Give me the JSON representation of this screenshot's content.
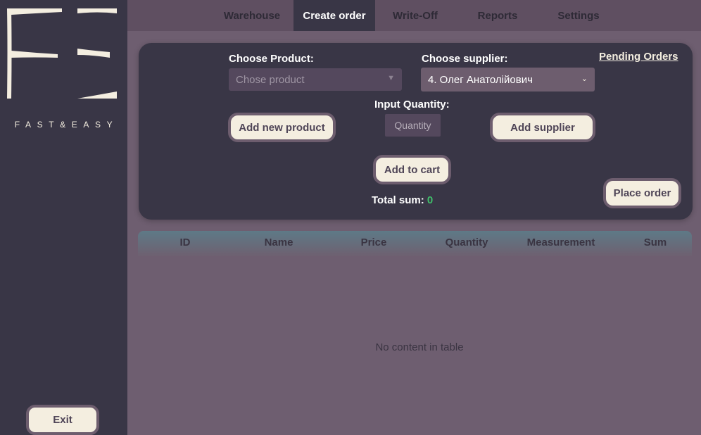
{
  "sidebar": {
    "logo_subtitle": "FAST&EASY",
    "exit_label": "Exit"
  },
  "nav": {
    "tabs": [
      {
        "label": "Warehouse"
      },
      {
        "label": "Create order"
      },
      {
        "label": "Write-Off"
      },
      {
        "label": "Reports"
      },
      {
        "label": "Settings"
      }
    ],
    "active_tab": "Create order"
  },
  "order_form": {
    "product_label": "Choose Product:",
    "product_placeholder": "Chose product",
    "supplier_label": "Choose supplier:",
    "supplier_value": "4. Олег Анатолійович",
    "pending_link": "Pending Orders",
    "quantity_label": "Input Quantity:",
    "quantity_placeholder": "Quantity",
    "add_product_label": "Add new product",
    "add_supplier_label": "Add supplier",
    "add_to_cart_label": "Add to cart",
    "total_label": "Total sum:",
    "total_value": "0",
    "place_order_label": "Place order"
  },
  "table": {
    "columns": [
      "ID",
      "Name",
      "Price",
      "Quantity",
      "Measurement",
      "Sum"
    ],
    "empty_text": "No content in table"
  },
  "colors": {
    "sidebar_bg": "#393646",
    "content_bg": "#6e5e70",
    "cream": "#f4eee0",
    "total_value": "#3fbf6a"
  }
}
